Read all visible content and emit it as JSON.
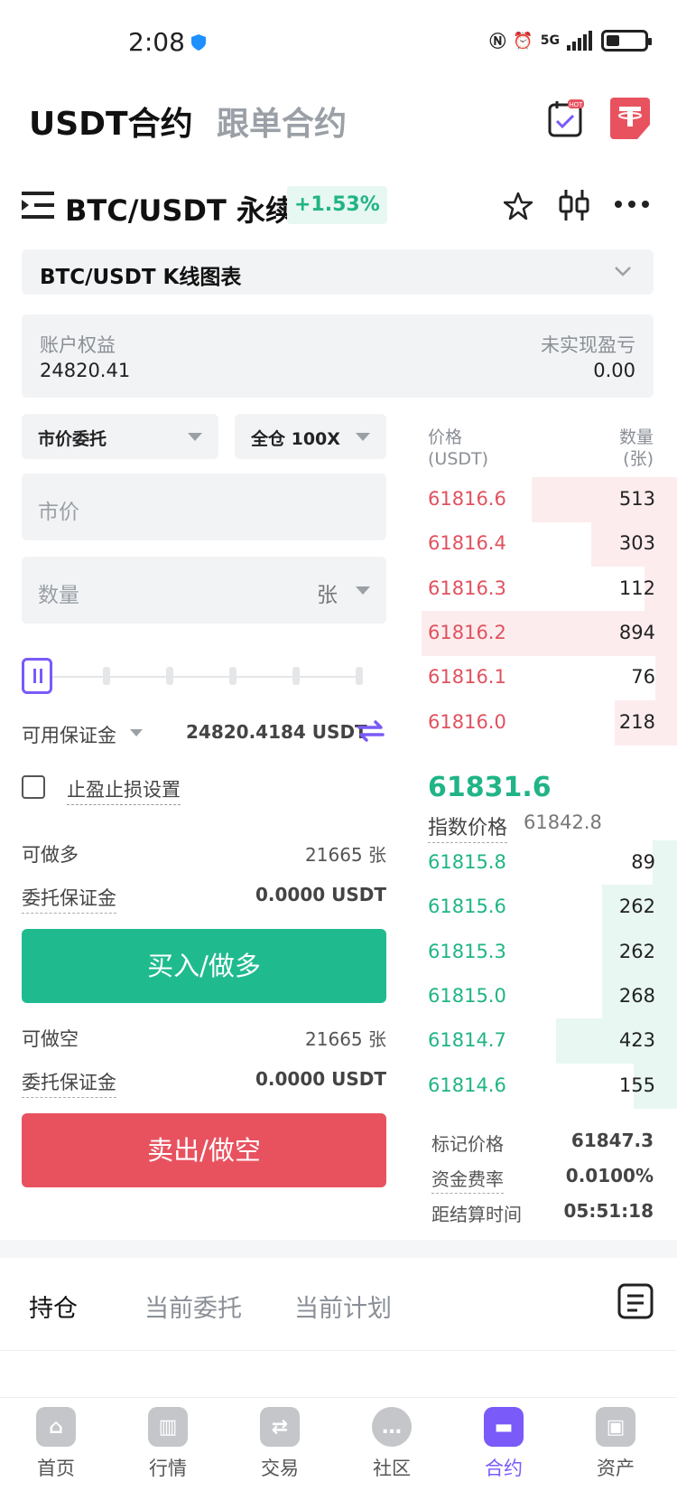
{
  "status_bar": {
    "time": "2:08",
    "network": "5G"
  },
  "header": {
    "tab_active": "USDT合约",
    "tab_inactive": "跟单合约",
    "hot_badge": "HOT"
  },
  "pair": {
    "name": "BTC/USDT 永续",
    "change": "+1.53%"
  },
  "kline": {
    "label": "BTC/USDT K线图表"
  },
  "equity": {
    "label_left": "账户权益",
    "value_left": "24820.41",
    "label_right": "未实现盈亏",
    "value_right": "0.00"
  },
  "form": {
    "order_type": "市价委托",
    "leverage": "全仓 100X",
    "price_placeholder": "市价",
    "qty_placeholder": "数量",
    "qty_unit": "张",
    "avail_label": "可用保证金",
    "avail_value": "24820.4184 USDT",
    "tp_sl_label": "止盈止损设置",
    "long_label": "可做多",
    "long_value": "21665 张",
    "margin_label": "委托保证金",
    "margin_value": "0.0000 USDT",
    "buy_button": "买入/做多",
    "short_label": "可做空",
    "short_value": "21665 张",
    "margin_label_2": "委托保证金",
    "margin_value_2": "0.0000 USDT",
    "sell_button": "卖出/做空"
  },
  "orderbook": {
    "header_price": "价格",
    "header_price_unit": "(USDT)",
    "header_qty": "数量",
    "header_qty_unit": "(张)",
    "asks": [
      {
        "price": "61816.6",
        "qty": "513",
        "depth": 0.54
      },
      {
        "price": "61816.4",
        "qty": "303",
        "depth": 0.32
      },
      {
        "price": "61816.3",
        "qty": "112",
        "depth": 0.12
      },
      {
        "price": "61816.2",
        "qty": "894",
        "depth": 0.95
      },
      {
        "price": "61816.1",
        "qty": "76",
        "depth": 0.08
      },
      {
        "price": "61816.0",
        "qty": "218",
        "depth": 0.23
      }
    ],
    "last_price": "61831.6",
    "index_label": "指数价格",
    "index_value": "61842.8",
    "bids": [
      {
        "price": "61815.8",
        "qty": "89",
        "depth": 0.09
      },
      {
        "price": "61815.6",
        "qty": "262",
        "depth": 0.28
      },
      {
        "price": "61815.3",
        "qty": "262",
        "depth": 0.28
      },
      {
        "price": "61815.0",
        "qty": "268",
        "depth": 0.28
      },
      {
        "price": "61814.7",
        "qty": "423",
        "depth": 0.45
      },
      {
        "price": "61814.6",
        "qty": "155",
        "depth": 0.16
      }
    ],
    "mark_label": "标记价格",
    "mark_value": "61847.3",
    "funding_label": "资金费率",
    "funding_value": "0.0100%",
    "settle_label": "距结算时间",
    "settle_value": "05:51:18"
  },
  "positions": {
    "tab1": "持仓",
    "tab2": "当前委托",
    "tab3": "当前计划"
  },
  "nav": [
    {
      "label": "首页",
      "icon": "home-icon"
    },
    {
      "label": "行情",
      "icon": "market-icon"
    },
    {
      "label": "交易",
      "icon": "trade-icon"
    },
    {
      "label": "社区",
      "icon": "community-icon"
    },
    {
      "label": "合约",
      "icon": "contract-icon"
    },
    {
      "label": "资产",
      "icon": "wallet-icon"
    }
  ],
  "colors": {
    "accent": "#7a5af8",
    "up": "#20b486",
    "down": "#e0525f"
  }
}
